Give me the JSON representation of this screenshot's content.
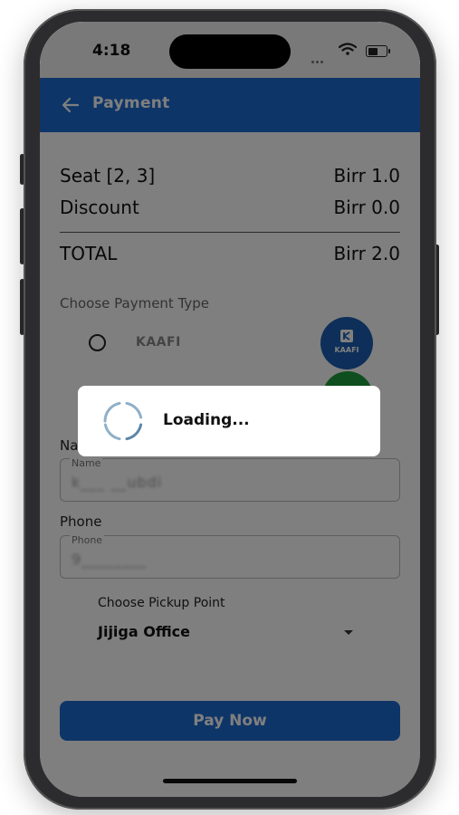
{
  "status_bar": {
    "time": "4:18",
    "battery_level": 0.55
  },
  "appbar": {
    "title": "Payment",
    "back_icon": "arrow-left-icon"
  },
  "summary": {
    "seat_label": "Seat [2, 3]",
    "seat_value": "Birr 1.0",
    "discount_label": "Discount",
    "discount_value": "Birr 0.0",
    "total_label": "TOTAL",
    "total_value": "Birr 2.0"
  },
  "payment": {
    "section_label": "Choose Payment Type",
    "options": [
      {
        "label": "KAAFI",
        "selected": false,
        "logo_text": "KAAFI",
        "logo_color": "#1b5fb3"
      }
    ],
    "second_logo_color": "#1e9e3e"
  },
  "form": {
    "name_label": "Name",
    "name_caption": "Name",
    "name_value": "k___ __ubdi",
    "phone_label": "Phone",
    "phone_caption": "Phone",
    "phone_value": "9________"
  },
  "pickup": {
    "caption": "Choose Pickup Point",
    "value": "Jijiga Office"
  },
  "pay_button": {
    "label": "Pay Now"
  },
  "loading_dialog": {
    "text": "Loading..."
  },
  "colors": {
    "primary": "#1c6bd0",
    "overlay": "rgba(0,0,0,0.5)"
  }
}
